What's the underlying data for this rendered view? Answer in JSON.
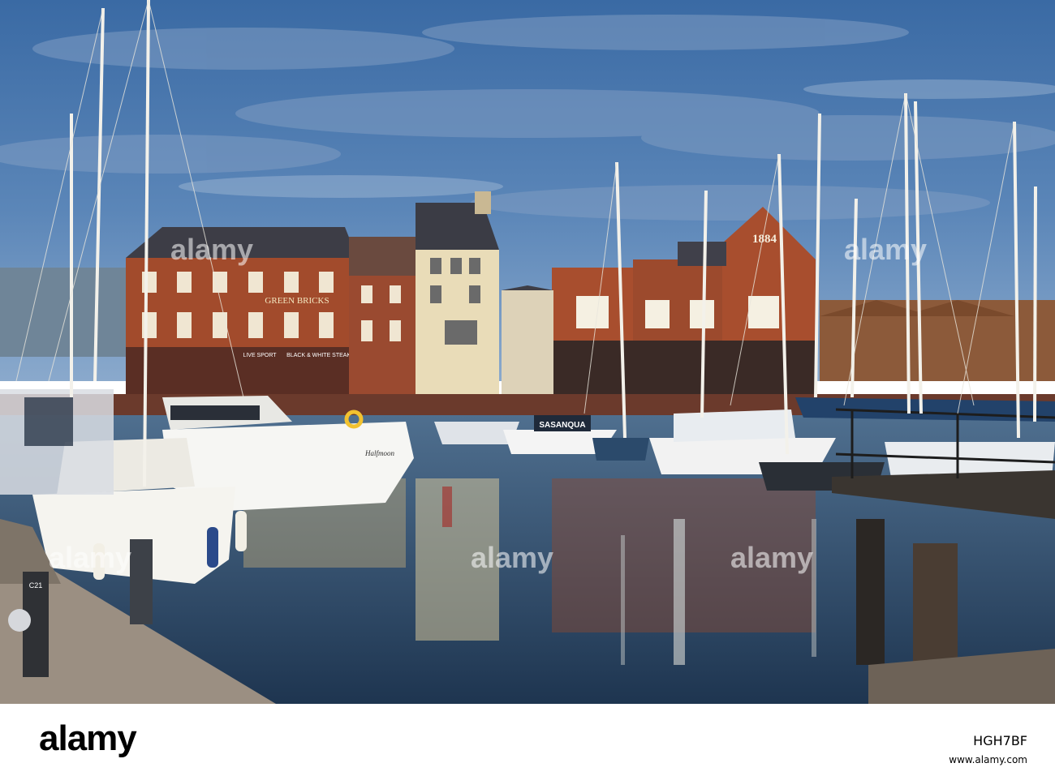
{
  "scene": {
    "building_left_sign": "GREEN BRICKS",
    "shop_sign_1": "LIVE SPORT",
    "shop_sign_2": "BLACK & WHITE STEAKS",
    "building_right_date": "1884",
    "boat_name": "SASANQUA",
    "motor_yacht_name": "Halfmoon",
    "pontoon_post_label": "C21"
  },
  "watermark": {
    "text": "alamy"
  },
  "footer": {
    "brand": "alamy",
    "stock_id": "HGH7BF",
    "info": "www.alamy.com"
  },
  "colors": {
    "sky": "#4a78b0",
    "brick": "#a34d2d",
    "water": "#2f4a64",
    "footer_bg": "#ffffff"
  }
}
